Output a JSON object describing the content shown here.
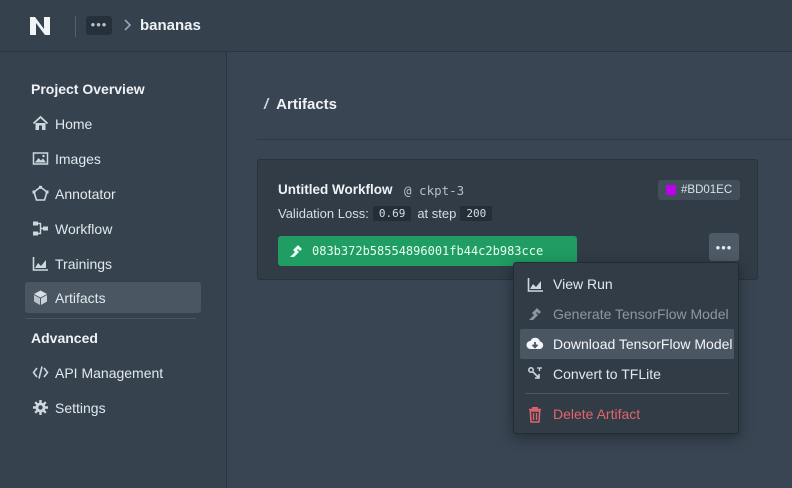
{
  "header": {
    "breadcrumb_more": "•••",
    "title": "bananas"
  },
  "sidebar": {
    "sections": [
      {
        "title": "Project Overview",
        "items": [
          {
            "label": "Home",
            "icon": "home-icon",
            "active": false
          },
          {
            "label": "Images",
            "icon": "image-icon",
            "active": false
          },
          {
            "label": "Annotator",
            "icon": "annotator-icon",
            "active": false
          },
          {
            "label": "Workflow",
            "icon": "workflow-icon",
            "active": false
          },
          {
            "label": "Trainings",
            "icon": "chart-icon",
            "active": false
          },
          {
            "label": "Artifacts",
            "icon": "cube-icon",
            "active": true
          }
        ]
      },
      {
        "title": "Advanced",
        "items": [
          {
            "label": "API Management",
            "icon": "code-icon",
            "active": false
          },
          {
            "label": "Settings",
            "icon": "gear-icon",
            "active": false
          }
        ]
      }
    ]
  },
  "main": {
    "heading_slash": "/",
    "heading": "Artifacts"
  },
  "artifact": {
    "workflow_name": "Untitled Workflow",
    "checkpoint": "@ ckpt-3",
    "color_tag": "#BD01EC",
    "validation_label": "Validation Loss:",
    "validation_value": "0.69",
    "step_label": "at step",
    "step_value": "200",
    "hash": "083b372b58554896001fb44c2b983cce",
    "more_label": "•••"
  },
  "menu": {
    "items": [
      {
        "label": "View Run",
        "icon": "chart-icon",
        "state": "normal"
      },
      {
        "label": "Generate TensorFlow Model",
        "icon": "build-icon",
        "state": "disabled"
      },
      {
        "label": "Download TensorFlow Model",
        "icon": "download-cloud-icon",
        "state": "hover"
      },
      {
        "label": "Convert to TFLite",
        "icon": "convert-icon",
        "state": "normal"
      },
      {
        "label": "Delete Artifact",
        "icon": "trash-icon",
        "state": "danger"
      }
    ]
  },
  "colors": {
    "accent_green": "#1f9d62",
    "tag_color": "#BD01EC",
    "danger": "#e2656b"
  }
}
